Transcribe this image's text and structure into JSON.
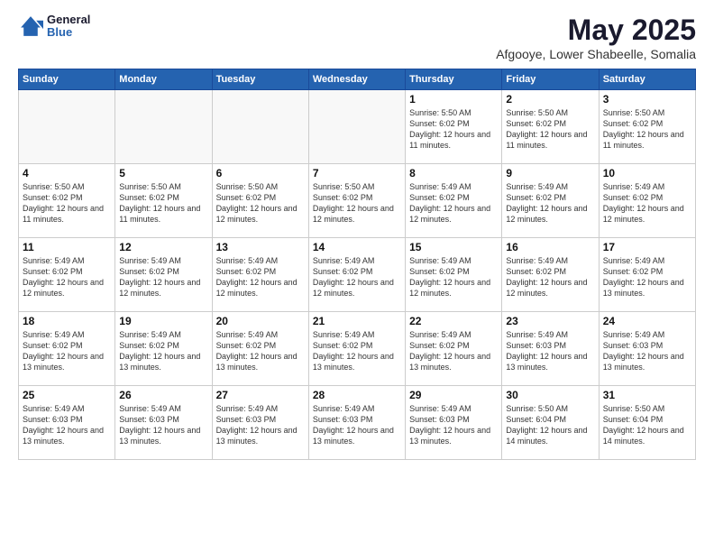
{
  "header": {
    "logo_general": "General",
    "logo_blue": "Blue",
    "month_title": "May 2025",
    "location": "Afgooye, Lower Shabeelle, Somalia"
  },
  "weekdays": [
    "Sunday",
    "Monday",
    "Tuesday",
    "Wednesday",
    "Thursday",
    "Friday",
    "Saturday"
  ],
  "weeks": [
    [
      {
        "day": "",
        "empty": true
      },
      {
        "day": "",
        "empty": true
      },
      {
        "day": "",
        "empty": true
      },
      {
        "day": "",
        "empty": true
      },
      {
        "day": "1",
        "sunrise": "5:50 AM",
        "sunset": "6:02 PM",
        "daylight": "12 hours and 11 minutes."
      },
      {
        "day": "2",
        "sunrise": "5:50 AM",
        "sunset": "6:02 PM",
        "daylight": "12 hours and 11 minutes."
      },
      {
        "day": "3",
        "sunrise": "5:50 AM",
        "sunset": "6:02 PM",
        "daylight": "12 hours and 11 minutes."
      }
    ],
    [
      {
        "day": "4",
        "sunrise": "5:50 AM",
        "sunset": "6:02 PM",
        "daylight": "12 hours and 11 minutes."
      },
      {
        "day": "5",
        "sunrise": "5:50 AM",
        "sunset": "6:02 PM",
        "daylight": "12 hours and 11 minutes."
      },
      {
        "day": "6",
        "sunrise": "5:50 AM",
        "sunset": "6:02 PM",
        "daylight": "12 hours and 12 minutes."
      },
      {
        "day": "7",
        "sunrise": "5:50 AM",
        "sunset": "6:02 PM",
        "daylight": "12 hours and 12 minutes."
      },
      {
        "day": "8",
        "sunrise": "5:49 AM",
        "sunset": "6:02 PM",
        "daylight": "12 hours and 12 minutes."
      },
      {
        "day": "9",
        "sunrise": "5:49 AM",
        "sunset": "6:02 PM",
        "daylight": "12 hours and 12 minutes."
      },
      {
        "day": "10",
        "sunrise": "5:49 AM",
        "sunset": "6:02 PM",
        "daylight": "12 hours and 12 minutes."
      }
    ],
    [
      {
        "day": "11",
        "sunrise": "5:49 AM",
        "sunset": "6:02 PM",
        "daylight": "12 hours and 12 minutes."
      },
      {
        "day": "12",
        "sunrise": "5:49 AM",
        "sunset": "6:02 PM",
        "daylight": "12 hours and 12 minutes."
      },
      {
        "day": "13",
        "sunrise": "5:49 AM",
        "sunset": "6:02 PM",
        "daylight": "12 hours and 12 minutes."
      },
      {
        "day": "14",
        "sunrise": "5:49 AM",
        "sunset": "6:02 PM",
        "daylight": "12 hours and 12 minutes."
      },
      {
        "day": "15",
        "sunrise": "5:49 AM",
        "sunset": "6:02 PM",
        "daylight": "12 hours and 12 minutes."
      },
      {
        "day": "16",
        "sunrise": "5:49 AM",
        "sunset": "6:02 PM",
        "daylight": "12 hours and 12 minutes."
      },
      {
        "day": "17",
        "sunrise": "5:49 AM",
        "sunset": "6:02 PM",
        "daylight": "12 hours and 13 minutes."
      }
    ],
    [
      {
        "day": "18",
        "sunrise": "5:49 AM",
        "sunset": "6:02 PM",
        "daylight": "12 hours and 13 minutes."
      },
      {
        "day": "19",
        "sunrise": "5:49 AM",
        "sunset": "6:02 PM",
        "daylight": "12 hours and 13 minutes."
      },
      {
        "day": "20",
        "sunrise": "5:49 AM",
        "sunset": "6:02 PM",
        "daylight": "12 hours and 13 minutes."
      },
      {
        "day": "21",
        "sunrise": "5:49 AM",
        "sunset": "6:02 PM",
        "daylight": "12 hours and 13 minutes."
      },
      {
        "day": "22",
        "sunrise": "5:49 AM",
        "sunset": "6:02 PM",
        "daylight": "12 hours and 13 minutes."
      },
      {
        "day": "23",
        "sunrise": "5:49 AM",
        "sunset": "6:03 PM",
        "daylight": "12 hours and 13 minutes."
      },
      {
        "day": "24",
        "sunrise": "5:49 AM",
        "sunset": "6:03 PM",
        "daylight": "12 hours and 13 minutes."
      }
    ],
    [
      {
        "day": "25",
        "sunrise": "5:49 AM",
        "sunset": "6:03 PM",
        "daylight": "12 hours and 13 minutes."
      },
      {
        "day": "26",
        "sunrise": "5:49 AM",
        "sunset": "6:03 PM",
        "daylight": "12 hours and 13 minutes."
      },
      {
        "day": "27",
        "sunrise": "5:49 AM",
        "sunset": "6:03 PM",
        "daylight": "12 hours and 13 minutes."
      },
      {
        "day": "28",
        "sunrise": "5:49 AM",
        "sunset": "6:03 PM",
        "daylight": "12 hours and 13 minutes."
      },
      {
        "day": "29",
        "sunrise": "5:49 AM",
        "sunset": "6:03 PM",
        "daylight": "12 hours and 13 minutes."
      },
      {
        "day": "30",
        "sunrise": "5:50 AM",
        "sunset": "6:04 PM",
        "daylight": "12 hours and 14 minutes."
      },
      {
        "day": "31",
        "sunrise": "5:50 AM",
        "sunset": "6:04 PM",
        "daylight": "12 hours and 14 minutes."
      }
    ]
  ]
}
